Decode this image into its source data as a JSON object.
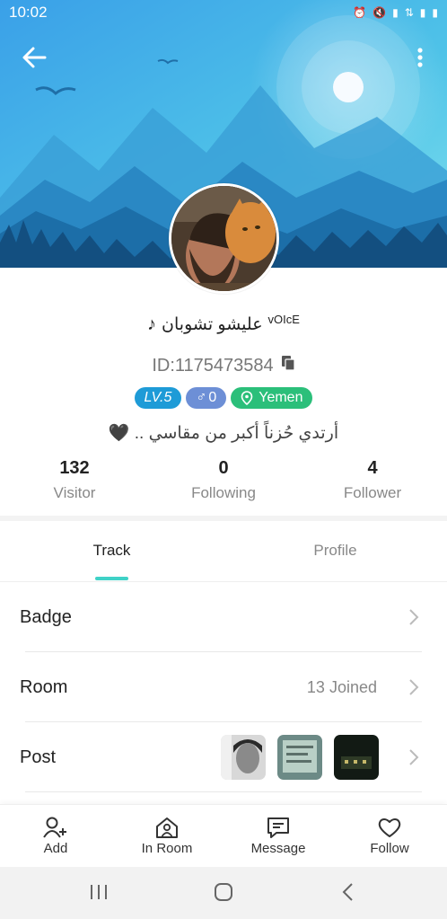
{
  "status_bar": {
    "time": "10:02",
    "icons": [
      "alarm-icon",
      "mute-icon",
      "signal-icon",
      "data-icon",
      "signal-icon"
    ]
  },
  "header": {
    "back_icon": "back-arrow-icon",
    "more_icon": "more-vert-icon"
  },
  "profile": {
    "name_prefix": "♪",
    "name": "ﻋﻠﻴﺸﻮ ﺗﺸﻮﺑﺎﻥ",
    "name_suffix": "vOIcE",
    "id_text": "ID:1175473584",
    "level": "LV.5",
    "gender_symbol": "♂",
    "gender_count": "0",
    "country": "Yemen",
    "bio": "أرتدي حُزناً أكبر من مقاسي .. 🖤"
  },
  "stats": [
    {
      "value": "132",
      "label": "Visitor"
    },
    {
      "value": "0",
      "label": "Following"
    },
    {
      "value": "4",
      "label": "Follower"
    }
  ],
  "tabs": [
    {
      "label": "Track",
      "active": true
    },
    {
      "label": "Profile",
      "active": false
    }
  ],
  "rows": {
    "badge": {
      "label": "Badge"
    },
    "room": {
      "label": "Room",
      "value": "13 Joined"
    },
    "post": {
      "label": "Post"
    }
  },
  "actions": [
    {
      "label": "Add",
      "icon": "add-user-icon"
    },
    {
      "label": "In Room",
      "icon": "in-room-icon"
    },
    {
      "label": "Message",
      "icon": "message-icon"
    },
    {
      "label": "Follow",
      "icon": "heart-icon"
    }
  ],
  "colors": {
    "accent": "#3fd2c7",
    "level_badge": "#1e9bd7",
    "gender_badge": "#6d8fd6",
    "country_badge": "#2bbf7a"
  }
}
